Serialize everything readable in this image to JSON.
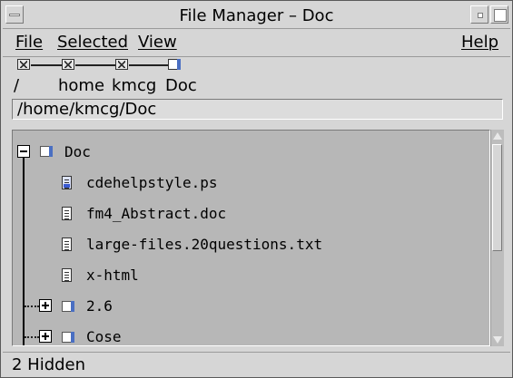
{
  "window": {
    "title": "File Manager – Doc"
  },
  "titlebar_icons": {
    "menu": "window-menu-icon",
    "minimize": "minimize-icon",
    "maximize": "maximize-icon"
  },
  "menubar": {
    "file": "File",
    "selected": "Selected",
    "view": "View",
    "help": "Help"
  },
  "path": {
    "segments": [
      {
        "label": "/",
        "icon": "locked-folder-icon"
      },
      {
        "label": "home",
        "icon": "locked-folder-icon"
      },
      {
        "label": "kmcg",
        "icon": "locked-folder-icon"
      },
      {
        "label": "Doc",
        "icon": "folder-icon"
      }
    ]
  },
  "location": {
    "value": "/home/kmcg/Doc"
  },
  "tree": {
    "root": {
      "label": "Doc",
      "expanded": true
    },
    "items": [
      {
        "label": "cdehelpstyle.ps",
        "type": "file",
        "icon": "postscript-file-icon"
      },
      {
        "label": "fm4_Abstract.doc",
        "type": "file",
        "icon": "document-file-icon"
      },
      {
        "label": "large-files.20questions.txt",
        "type": "file",
        "icon": "document-file-icon"
      },
      {
        "label": "x-html",
        "type": "file",
        "icon": "document-file-icon"
      },
      {
        "label": "2.6",
        "type": "folder",
        "icon": "folder-icon",
        "expanded": false
      },
      {
        "label": "Cose",
        "type": "folder",
        "icon": "folder-icon",
        "expanded": false
      }
    ]
  },
  "status": {
    "text": "2 Hidden"
  },
  "colors": {
    "folder_accent": "#4a6fc2",
    "tree_background": "#b7b7b7",
    "chrome": "#d6d6d6"
  }
}
